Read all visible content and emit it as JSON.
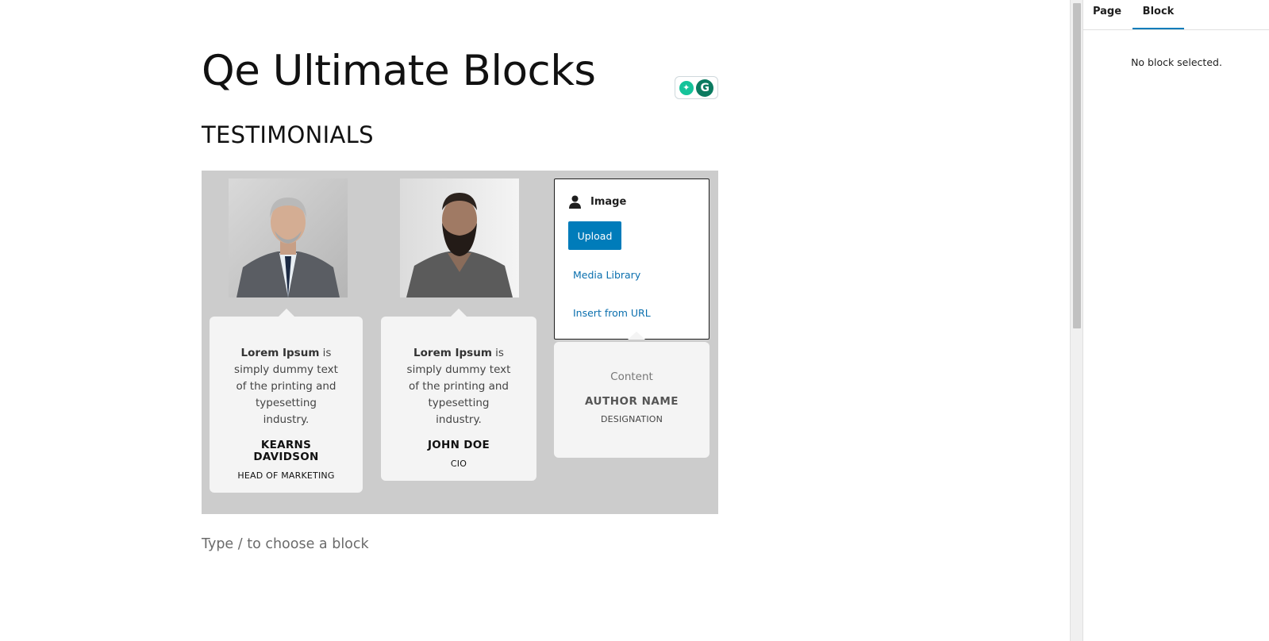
{
  "editor": {
    "title": "Qe Ultimate Blocks",
    "section_heading": "TESTIMONIALS",
    "block_prompt": "Type / to choose a block"
  },
  "testimonials": [
    {
      "quote_bold": "Lorem Ipsum",
      "quote_rest": " is simply dummy text of the printing and typesetting industry.",
      "author": "KEARNS DAVIDSON",
      "designation": "HEAD OF MARKETING",
      "photo": "man-grey-suit-portrait"
    },
    {
      "quote_bold": "Lorem Ipsum",
      "quote_rest": " is simply dummy text of the printing and typesetting industry.",
      "author": "JOHN DOE",
      "designation": "CIO",
      "photo": "bearded-man-tshirt-portrait"
    }
  ],
  "image_placeholder": {
    "label": "Image",
    "icon": "person-icon",
    "upload_label": "Upload",
    "media_library_label": "Media Library",
    "insert_url_label": "Insert from URL"
  },
  "placeholder_card": {
    "content": "Content",
    "author": "AUTHOR NAME",
    "designation": "DESIGNATION"
  },
  "sidebar": {
    "tabs": [
      {
        "label": "Page",
        "active": false
      },
      {
        "label": "Block",
        "active": true
      }
    ],
    "empty_message": "No block selected."
  },
  "colors": {
    "accent": "#007cba",
    "block_background": "#cccccc",
    "card_background": "#f4f4f4",
    "grammarly_green": "#15c39a"
  }
}
